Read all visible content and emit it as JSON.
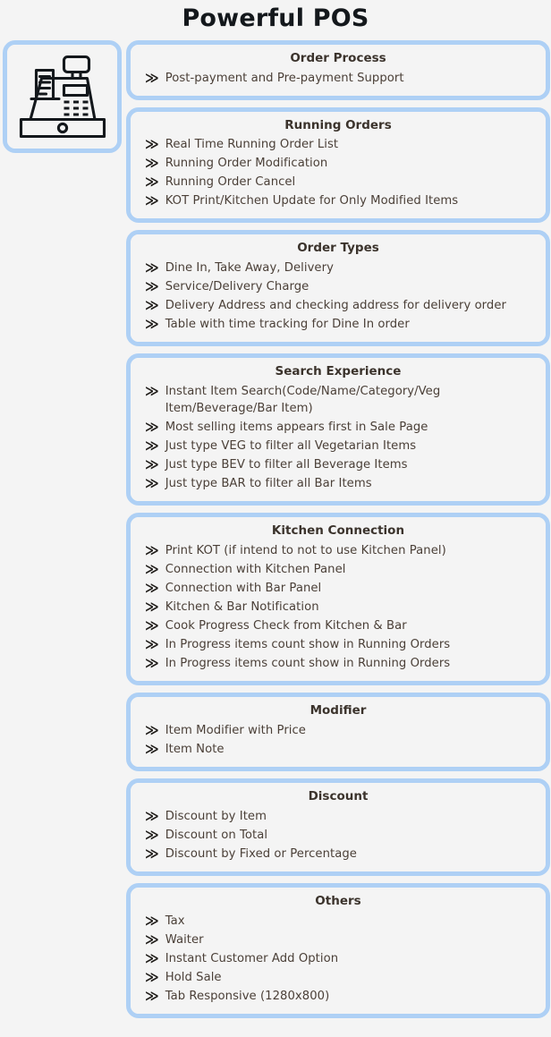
{
  "header": {
    "title": "Powerful POS"
  },
  "icon_panel": {
    "icon": "cash-register-icon",
    "accent_color": "#aed0f5",
    "surface_color": "#f4f4f4",
    "line_color": "#14181c"
  },
  "bullet_glyph": "≫",
  "colors": {
    "background": "#f4f4f4",
    "card_border": "#aed0f5",
    "card_surface": "#f4f4f4",
    "title_text": "#14181c",
    "heading_text": "#3b332c",
    "body_text": "#4b4038"
  },
  "sections": [
    {
      "title": "Order Process",
      "items": [
        "Post-payment and Pre-payment Support"
      ]
    },
    {
      "title": "Running Orders",
      "items": [
        "Real Time Running Order List",
        "Running Order Modification",
        "Running Order Cancel",
        "KOT Print/Kitchen Update for Only Modified Items"
      ]
    },
    {
      "title": "Order Types",
      "items": [
        "Dine In, Take Away, Delivery",
        "Service/Delivery Charge",
        "Delivery Address and checking address for delivery order",
        "Table with time tracking for Dine In order"
      ]
    },
    {
      "title": "Search Experience",
      "items": [
        "Instant Item Search(Code/Name/Category/Veg Item/Beverage/Bar Item)",
        "Most selling items appears first in Sale Page",
        "Just type VEG to filter all Vegetarian Items",
        "Just type BEV to filter all Beverage Items",
        "Just type BAR to filter all Bar Items"
      ]
    },
    {
      "title": "Kitchen Connection",
      "items": [
        "Print KOT (if intend to not to use Kitchen Panel)",
        "Connection with Kitchen Panel",
        "Connection with Bar Panel",
        "Kitchen & Bar Notification",
        "Cook Progress Check from Kitchen & Bar",
        "In Progress items count show in Running Orders",
        "In Progress items count show in Running Orders"
      ]
    },
    {
      "title": "Modifier",
      "items": [
        "Item Modifier with Price",
        "Item Note"
      ]
    },
    {
      "title": "Discount",
      "items": [
        "Discount by Item",
        "Discount on Total",
        "Discount by Fixed or Percentage"
      ]
    },
    {
      "title": "Others",
      "items": [
        "Tax",
        "Waiter",
        "Instant Customer Add Option",
        "Hold Sale",
        "Tab Responsive (1280x800)"
      ]
    }
  ]
}
